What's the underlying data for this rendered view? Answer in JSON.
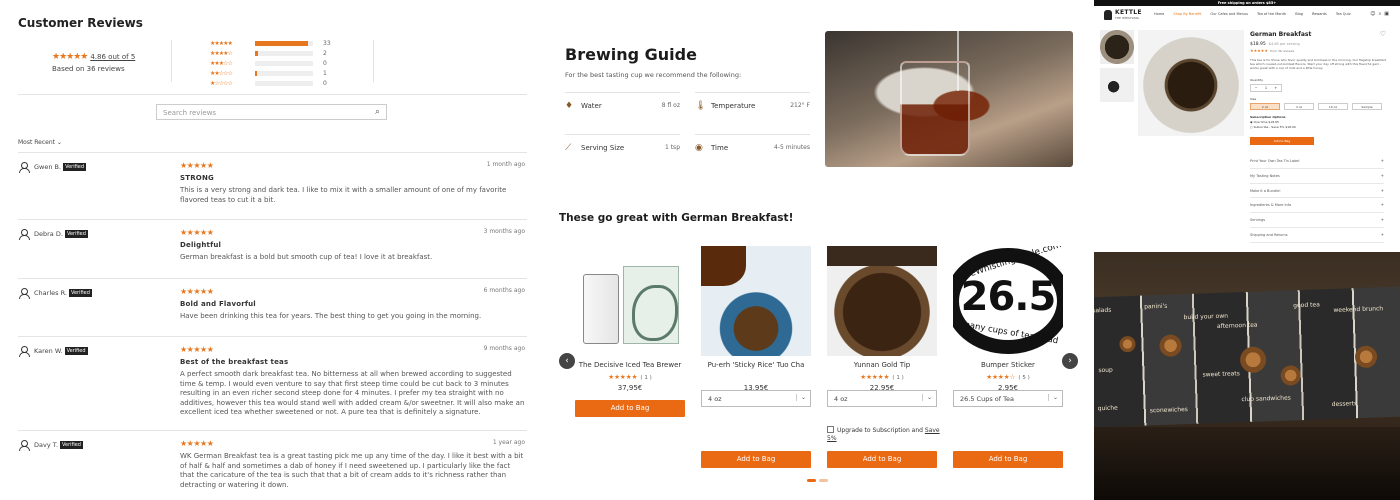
{
  "reviews_panel": {
    "title": "Customer Reviews",
    "average_text": "4.86 out of 5",
    "based_on": "Based on 36 reviews",
    "histogram": [
      {
        "stars": 5,
        "count": "33",
        "fraction": 0.92
      },
      {
        "stars": 4,
        "count": "2",
        "fraction": 0.06
      },
      {
        "stars": 3,
        "count": "0",
        "fraction": 0.0
      },
      {
        "stars": 2,
        "count": "1",
        "fraction": 0.03
      },
      {
        "stars": 1,
        "count": "0",
        "fraction": 0.0
      }
    ],
    "search_placeholder": "Search reviews",
    "sort_label": "Most Recent",
    "verified_label": "Verified",
    "reviews": [
      {
        "author": "Gwen B.",
        "date": "1 month ago",
        "rating": 5,
        "title": "STRONG",
        "body": "This is a very strong and dark tea. I like to mix it with a smaller amount of one of my favorite flavored teas to cut it a bit."
      },
      {
        "author": "Debra D.",
        "date": "3 months ago",
        "rating": 5,
        "title": "Delightful",
        "body": "German breakfast is a bold but smooth cup of tea! I love it at breakfast."
      },
      {
        "author": "Charles R.",
        "date": "6 months ago",
        "rating": 5,
        "title": "Bold and Flavorful",
        "body": "Have been drinking this tea for years. The best thing to get you going in the morning."
      },
      {
        "author": "Karen W.",
        "date": "9 months ago",
        "rating": 5,
        "title": "Best of the breakfast teas",
        "body": "A perfect smooth dark breakfast tea. No bitterness at all when brewed according to suggested time & temp. I would even venture to say that first steep time could be cut back to 3 minutes resulting in an even richer second steep done for 4 minutes. I prefer my tea straight with no additives, however this tea would stand well with added cream &/or sweetner. It will also make an excellent iced tea whether sweetened or not. A pure tea that is definitely a signature."
      },
      {
        "author": "Davy T.",
        "date": "1 year ago",
        "rating": 5,
        "title": "",
        "body": "WK German Breakfast tea is a great tasting pick me up any time of the day. I like it best with a bit of half & half and sometimes a dab of honey if I need sweetened up. I particularly like the fact that the caricature of the tea is such that that a bit of cream adds to it's richness rather than detracting or watering it down."
      }
    ]
  },
  "brewing": {
    "title": "Brewing Guide",
    "subtitle": "For the best tasting cup we recommend the following:",
    "items": [
      {
        "icon": "water-drop-icon",
        "label": "Water",
        "value": "8 fl oz"
      },
      {
        "icon": "thermometer-icon",
        "label": "Temperature",
        "value": "212° F"
      },
      {
        "icon": "spoon-icon",
        "label": "Serving Size",
        "value": "1 tsp"
      },
      {
        "icon": "timer-icon",
        "label": "Time",
        "value": "4-5 minutes"
      }
    ],
    "pairing_title": "These go great with German Breakfast!",
    "products": [
      {
        "name": "The Decisive Iced Tea Brewer",
        "rating": 5,
        "reviews": "( 1 )",
        "price": "37,95€",
        "select": "",
        "button": "Add to Bag"
      },
      {
        "name": "Pu-erh 'Sticky Rice' Tuo Cha",
        "rating": 0,
        "reviews": "",
        "price": "13,95€",
        "select": "4 oz",
        "button": "Add to Bag"
      },
      {
        "name": "Yunnan Gold Tip",
        "rating": 5,
        "reviews": "( 1 )",
        "price": "22,95€",
        "select": "4 oz",
        "button": "Add to Bag",
        "subscription": "Upgrade to Subscription and",
        "save": "Save 5%"
      },
      {
        "name": "Bumper Sticker",
        "rating": 4.5,
        "reviews": "( 5 )",
        "price": "2,95€",
        "select": "26.5 Cups of Tea",
        "button": "Add to Bag",
        "sticker_top": "theWhistlingKettle.com",
        "sticker_num": "26.5",
        "sticker_bottom": "many cups of tea I had"
      }
    ],
    "prev_arrow": "‹",
    "next_arrow": "›"
  },
  "store": {
    "promo": "Free shipping on orders $85+",
    "logo_word": "KETTLE",
    "logo_small": "THE WHISTLING",
    "nav": [
      "Home",
      "Shop By Benefit",
      "Our Cafes and Menus",
      "Tea of the Month",
      "Blog",
      "Rewards",
      "Tea Quiz"
    ],
    "nav_active": 1,
    "product_title": "German Breakfast",
    "price": "$18.95",
    "old_price": "$4.65 per serving",
    "reviews_count": "from 36 reviews",
    "description": "This tea is for those who favor quality and boldness in the morning. Our flagship breakfast tea which coaxed-out-boldest flavors. Start your day off strong with this flavorful gem - works great with a cup of milk and a little honey.",
    "quantity_label": "Quantity",
    "quantity": "1",
    "size_label": "Size",
    "sizes": [
      "2 oz",
      "4 oz",
      "16 oz",
      "Sample"
    ],
    "subscription_label": "Subscription Options",
    "sub_options": [
      "One time   $18.95",
      "Subscribe - Save 5%   $18.00"
    ],
    "add_button": "Add to Bag",
    "accordion": [
      "Print Your Own Tea Tin Label",
      "My Tasting Notes",
      "Make it a Bundle!",
      "Ingredients & More Info",
      "Servings",
      "Shipping and Returns"
    ]
  },
  "cafe_photo": {
    "labels": [
      "salads",
      "panini's",
      "build your own",
      "afternoon tea",
      "good tea",
      "weekend brunch",
      "soup",
      "quiche",
      "sweet treats",
      "club sandwiches",
      "desserts",
      "sconewiches"
    ]
  }
}
